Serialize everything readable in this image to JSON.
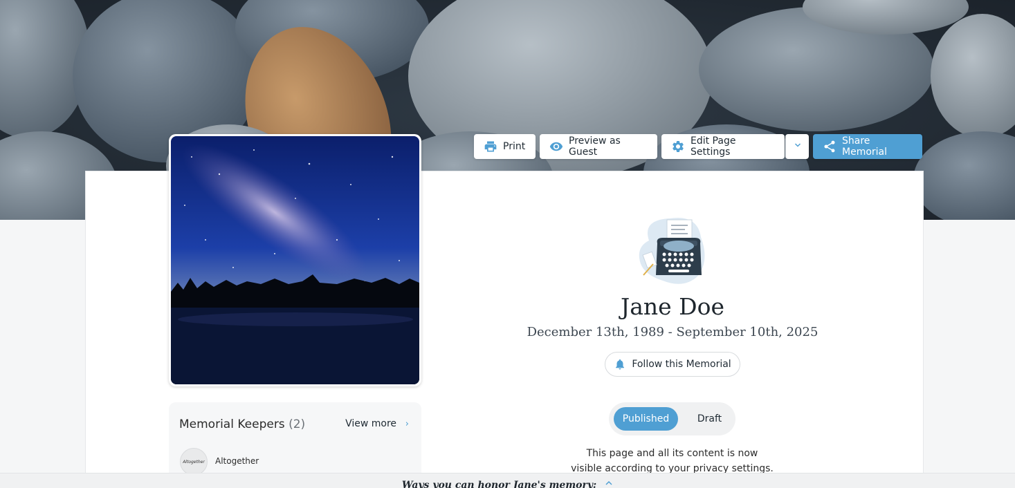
{
  "toolbar": {
    "print_label": "Print",
    "preview_label": "Preview as Guest",
    "edit_label": "Edit Page Settings",
    "share_label": "Share Memorial",
    "share_color": "#4f9fd3"
  },
  "memorial": {
    "name": "Jane Doe",
    "dates": "December 13th, 1989 - September 10th, 2025",
    "follow_label": "Follow this Memorial"
  },
  "status_toggle": {
    "published_label": "Published",
    "draft_label": "Draft",
    "selected": "Published"
  },
  "privacy_note": {
    "line1": "This page and all its content is now",
    "line2": "visible according to your privacy settings."
  },
  "keepers": {
    "title": "Memorial Keepers",
    "count": "(2)",
    "view_more": "View more",
    "items": [
      {
        "avatar_text": "Altogether",
        "name": "Altogether"
      }
    ]
  },
  "bottom_bar": {
    "text": "Ways you can honor Jane's memory:"
  },
  "icons": {
    "print": "printer-icon",
    "preview": "eye-icon",
    "edit": "gear-icon",
    "dropdown": "chevron-down-icon",
    "share": "share-icon",
    "follow": "bell-icon",
    "view_more": "chevron-right-icon",
    "bottom": "chevron-up-icon"
  }
}
